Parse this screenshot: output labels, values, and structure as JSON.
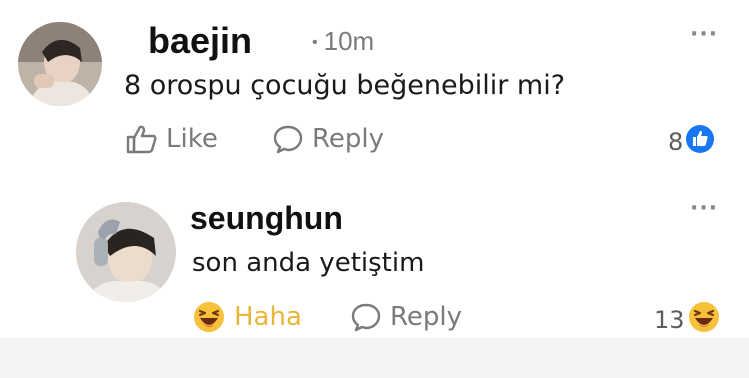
{
  "post": {
    "username": "baejin",
    "time_separator": "•",
    "time": "10m",
    "text": "8 orospu çocuğu beğenebilir mi?",
    "more_label": "···",
    "actions": {
      "like_label": "Like",
      "reply_label": "Reply"
    },
    "reaction_count": "8",
    "reaction_icon": "like-reaction-icon",
    "reaction_color": "#1877f2"
  },
  "reply": {
    "username": "seunghun",
    "text": "son anda yetiştim",
    "more_label": "···",
    "actions": {
      "haha_label": "Haha",
      "reply_label": "Reply"
    },
    "reaction_count": "13",
    "reaction_icon": "haha-reaction-icon",
    "reaction_color": "#f7c13a"
  },
  "colors": {
    "action_gray": "#7a7a7a",
    "haha_text": "#e9b53a"
  }
}
